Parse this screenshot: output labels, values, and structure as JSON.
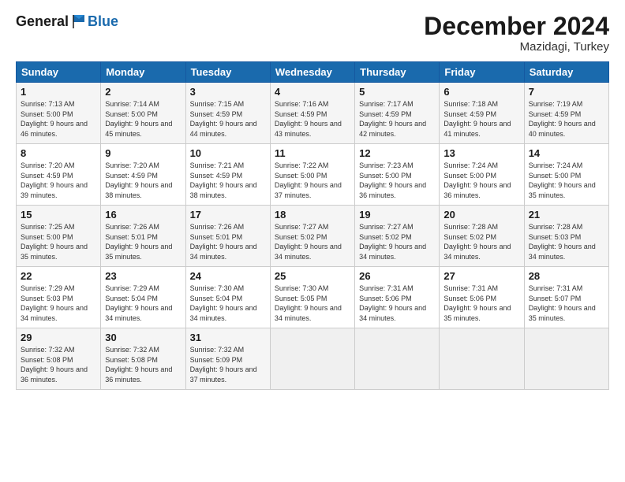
{
  "logo": {
    "general": "General",
    "blue": "Blue"
  },
  "header": {
    "month": "December 2024",
    "location": "Mazidagi, Turkey"
  },
  "weekdays": [
    "Sunday",
    "Monday",
    "Tuesday",
    "Wednesday",
    "Thursday",
    "Friday",
    "Saturday"
  ],
  "weeks": [
    [
      {
        "day": "1",
        "sunrise": "7:13 AM",
        "sunset": "5:00 PM",
        "daylight": "9 hours and 46 minutes."
      },
      {
        "day": "2",
        "sunrise": "7:14 AM",
        "sunset": "5:00 PM",
        "daylight": "9 hours and 45 minutes."
      },
      {
        "day": "3",
        "sunrise": "7:15 AM",
        "sunset": "4:59 PM",
        "daylight": "9 hours and 44 minutes."
      },
      {
        "day": "4",
        "sunrise": "7:16 AM",
        "sunset": "4:59 PM",
        "daylight": "9 hours and 43 minutes."
      },
      {
        "day": "5",
        "sunrise": "7:17 AM",
        "sunset": "4:59 PM",
        "daylight": "9 hours and 42 minutes."
      },
      {
        "day": "6",
        "sunrise": "7:18 AM",
        "sunset": "4:59 PM",
        "daylight": "9 hours and 41 minutes."
      },
      {
        "day": "7",
        "sunrise": "7:19 AM",
        "sunset": "4:59 PM",
        "daylight": "9 hours and 40 minutes."
      }
    ],
    [
      {
        "day": "8",
        "sunrise": "7:20 AM",
        "sunset": "4:59 PM",
        "daylight": "9 hours and 39 minutes."
      },
      {
        "day": "9",
        "sunrise": "7:20 AM",
        "sunset": "4:59 PM",
        "daylight": "9 hours and 38 minutes."
      },
      {
        "day": "10",
        "sunrise": "7:21 AM",
        "sunset": "4:59 PM",
        "daylight": "9 hours and 38 minutes."
      },
      {
        "day": "11",
        "sunrise": "7:22 AM",
        "sunset": "5:00 PM",
        "daylight": "9 hours and 37 minutes."
      },
      {
        "day": "12",
        "sunrise": "7:23 AM",
        "sunset": "5:00 PM",
        "daylight": "9 hours and 36 minutes."
      },
      {
        "day": "13",
        "sunrise": "7:24 AM",
        "sunset": "5:00 PM",
        "daylight": "9 hours and 36 minutes."
      },
      {
        "day": "14",
        "sunrise": "7:24 AM",
        "sunset": "5:00 PM",
        "daylight": "9 hours and 35 minutes."
      }
    ],
    [
      {
        "day": "15",
        "sunrise": "7:25 AM",
        "sunset": "5:00 PM",
        "daylight": "9 hours and 35 minutes."
      },
      {
        "day": "16",
        "sunrise": "7:26 AM",
        "sunset": "5:01 PM",
        "daylight": "9 hours and 35 minutes."
      },
      {
        "day": "17",
        "sunrise": "7:26 AM",
        "sunset": "5:01 PM",
        "daylight": "9 hours and 34 minutes."
      },
      {
        "day": "18",
        "sunrise": "7:27 AM",
        "sunset": "5:02 PM",
        "daylight": "9 hours and 34 minutes."
      },
      {
        "day": "19",
        "sunrise": "7:27 AM",
        "sunset": "5:02 PM",
        "daylight": "9 hours and 34 minutes."
      },
      {
        "day": "20",
        "sunrise": "7:28 AM",
        "sunset": "5:02 PM",
        "daylight": "9 hours and 34 minutes."
      },
      {
        "day": "21",
        "sunrise": "7:28 AM",
        "sunset": "5:03 PM",
        "daylight": "9 hours and 34 minutes."
      }
    ],
    [
      {
        "day": "22",
        "sunrise": "7:29 AM",
        "sunset": "5:03 PM",
        "daylight": "9 hours and 34 minutes."
      },
      {
        "day": "23",
        "sunrise": "7:29 AM",
        "sunset": "5:04 PM",
        "daylight": "9 hours and 34 minutes."
      },
      {
        "day": "24",
        "sunrise": "7:30 AM",
        "sunset": "5:04 PM",
        "daylight": "9 hours and 34 minutes."
      },
      {
        "day": "25",
        "sunrise": "7:30 AM",
        "sunset": "5:05 PM",
        "daylight": "9 hours and 34 minutes."
      },
      {
        "day": "26",
        "sunrise": "7:31 AM",
        "sunset": "5:06 PM",
        "daylight": "9 hours and 34 minutes."
      },
      {
        "day": "27",
        "sunrise": "7:31 AM",
        "sunset": "5:06 PM",
        "daylight": "9 hours and 35 minutes."
      },
      {
        "day": "28",
        "sunrise": "7:31 AM",
        "sunset": "5:07 PM",
        "daylight": "9 hours and 35 minutes."
      }
    ],
    [
      {
        "day": "29",
        "sunrise": "7:32 AM",
        "sunset": "5:08 PM",
        "daylight": "9 hours and 36 minutes."
      },
      {
        "day": "30",
        "sunrise": "7:32 AM",
        "sunset": "5:08 PM",
        "daylight": "9 hours and 36 minutes."
      },
      {
        "day": "31",
        "sunrise": "7:32 AM",
        "sunset": "5:09 PM",
        "daylight": "9 hours and 37 minutes."
      },
      null,
      null,
      null,
      null
    ]
  ],
  "labels": {
    "sunrise": "Sunrise:",
    "sunset": "Sunset:",
    "daylight": "Daylight:"
  }
}
